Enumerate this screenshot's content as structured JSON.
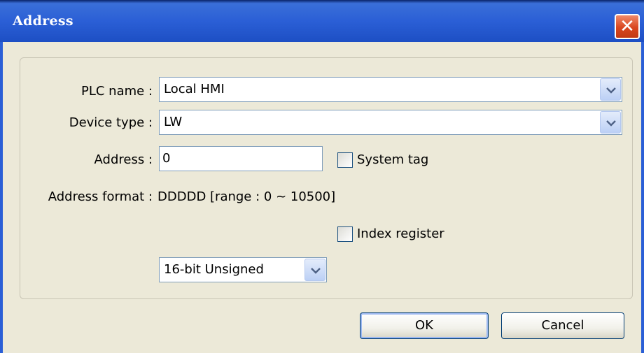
{
  "window": {
    "title": "Address"
  },
  "form": {
    "plc_name_label": "PLC name :",
    "plc_name_value": "Local HMI",
    "device_type_label": "Device type :",
    "device_type_value": "LW",
    "address_label": "Address :",
    "address_value": "0",
    "system_tag_label": "System tag",
    "system_tag_checked": false,
    "address_format_label": "Address format :",
    "address_format_value": "DDDDD [range : 0 ~ 10500]",
    "index_register_label": "Index register",
    "index_register_checked": false,
    "data_format_value": "16-bit Unsigned"
  },
  "buttons": {
    "ok_label": "OK",
    "cancel_label": "Cancel"
  },
  "icons": {
    "close": "close-icon",
    "dropdown": "chevron-down-icon"
  }
}
